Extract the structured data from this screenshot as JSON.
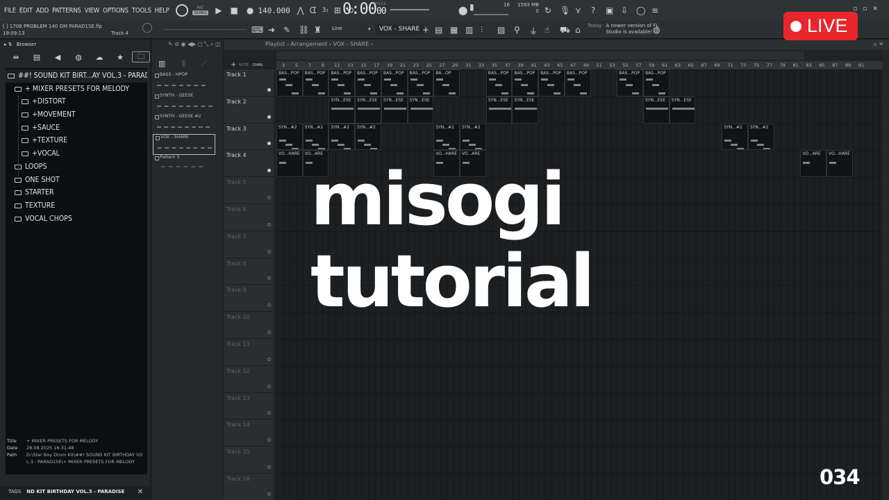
{
  "menu": [
    "FILE",
    "EDIT",
    "ADD",
    "PATTERNS",
    "VIEW",
    "OPTIONS",
    "TOOLS",
    "HELP"
  ],
  "transport": {
    "pat_label": "PAT",
    "song_label": "SONG",
    "tempo": "140.000",
    "time": "0:00",
    "time_sub": "00",
    "time_unit": "M:S:CS",
    "cpu_value": "16",
    "memory": "1593 MB",
    "voices": "0"
  },
  "project": {
    "file": "[ ] 1706 PROBLEM 140 GM PARAD1SE.flp",
    "clock": "19:09:13",
    "track_hint": "Track 4"
  },
  "toolbar": {
    "snap": "Line",
    "pattern": "VOX - SHARE"
  },
  "news": {
    "today": "Today",
    "message": "A newer version of FL Studio is available!"
  },
  "browser": {
    "title": "Browser",
    "items": [
      {
        "label": "##! SOUND KIT BIRT...AY VOL.3 - PARAD1SE",
        "level": 0
      },
      {
        "label": "+ MIXER PRESETS FOR MELODY",
        "level": 1
      },
      {
        "label": "+DISTORT",
        "level": 2
      },
      {
        "label": "+MOVEMENT",
        "level": 2
      },
      {
        "label": "+SAUCE",
        "level": 2
      },
      {
        "label": "+TEXTURE",
        "level": 2
      },
      {
        "label": "+VOCAL",
        "level": 2
      },
      {
        "label": "LOOPS",
        "level": 1
      },
      {
        "label": "ONE SHOT",
        "level": 1
      },
      {
        "label": "STARTER",
        "level": 1
      },
      {
        "label": "TEXTURE",
        "level": 1
      },
      {
        "label": "VOCAL CHOPS",
        "level": 1
      }
    ],
    "meta": {
      "title_key": "Title",
      "title_val": "+ MIXER PRESETS FOR MELODY",
      "date_key": "Date",
      "date_val": "28.08.2025 16:31:48",
      "path_key": "Path",
      "path_val": "D:\\Star Boy Drum Kit\\##! SOUND KIT BIRTHDAY VOL.3 - PARAD1SE\\+ MIXER PRESETS FOR MELODY"
    },
    "tags_key": "TAGS",
    "tags_val": "ND KIT BIRTHDAY VOL.3 - PARADISE"
  },
  "patterns": [
    {
      "label": "BASS - HPOP"
    },
    {
      "label": "SYNTH - GEESE"
    },
    {
      "label": "SYNTH - GEESE #2"
    },
    {
      "label": "VOX - SHARE"
    },
    {
      "label": "Pattern 5"
    }
  ],
  "picker_tabs": {
    "note": "NOTE",
    "chan": "CHAN"
  },
  "playlist": {
    "title": "Playlist - Arrangement › VOX - SHARE ›",
    "ruler": [
      "3",
      "5",
      "7",
      "9",
      "11",
      "13",
      "15",
      "17",
      "19",
      "21",
      "23",
      "25",
      "27",
      "29",
      "31",
      "33",
      "35",
      "37",
      "39",
      "41",
      "43",
      "45",
      "47",
      "49",
      "51",
      "53",
      "55",
      "57",
      "59",
      "61",
      "63",
      "65",
      "67",
      "69",
      "71",
      "73",
      "75",
      "77",
      "79",
      "81",
      "83",
      "85",
      "87",
      "89",
      "91"
    ],
    "tracks": [
      "Track 1",
      "Track 2",
      "Track 3",
      "Track 4",
      "Track 5",
      "Track 6",
      "Track 7",
      "Track 8",
      "Track 9",
      "Track 10",
      "Track 11",
      "Track 12",
      "Track 13",
      "Track 14",
      "Track 15",
      "Track 16"
    ],
    "clip_labels": {
      "bass": "BAS...POP",
      "bass_alt": "BA...OP",
      "synth": "SYN...ESE",
      "synth2": "SYN...#2",
      "vox": "VO...HARE",
      "vox_alt": "VO...ARE"
    }
  },
  "overlay": {
    "line1": "misogi",
    "line2": "tutorial",
    "live": "LIVE",
    "episode": "034"
  }
}
